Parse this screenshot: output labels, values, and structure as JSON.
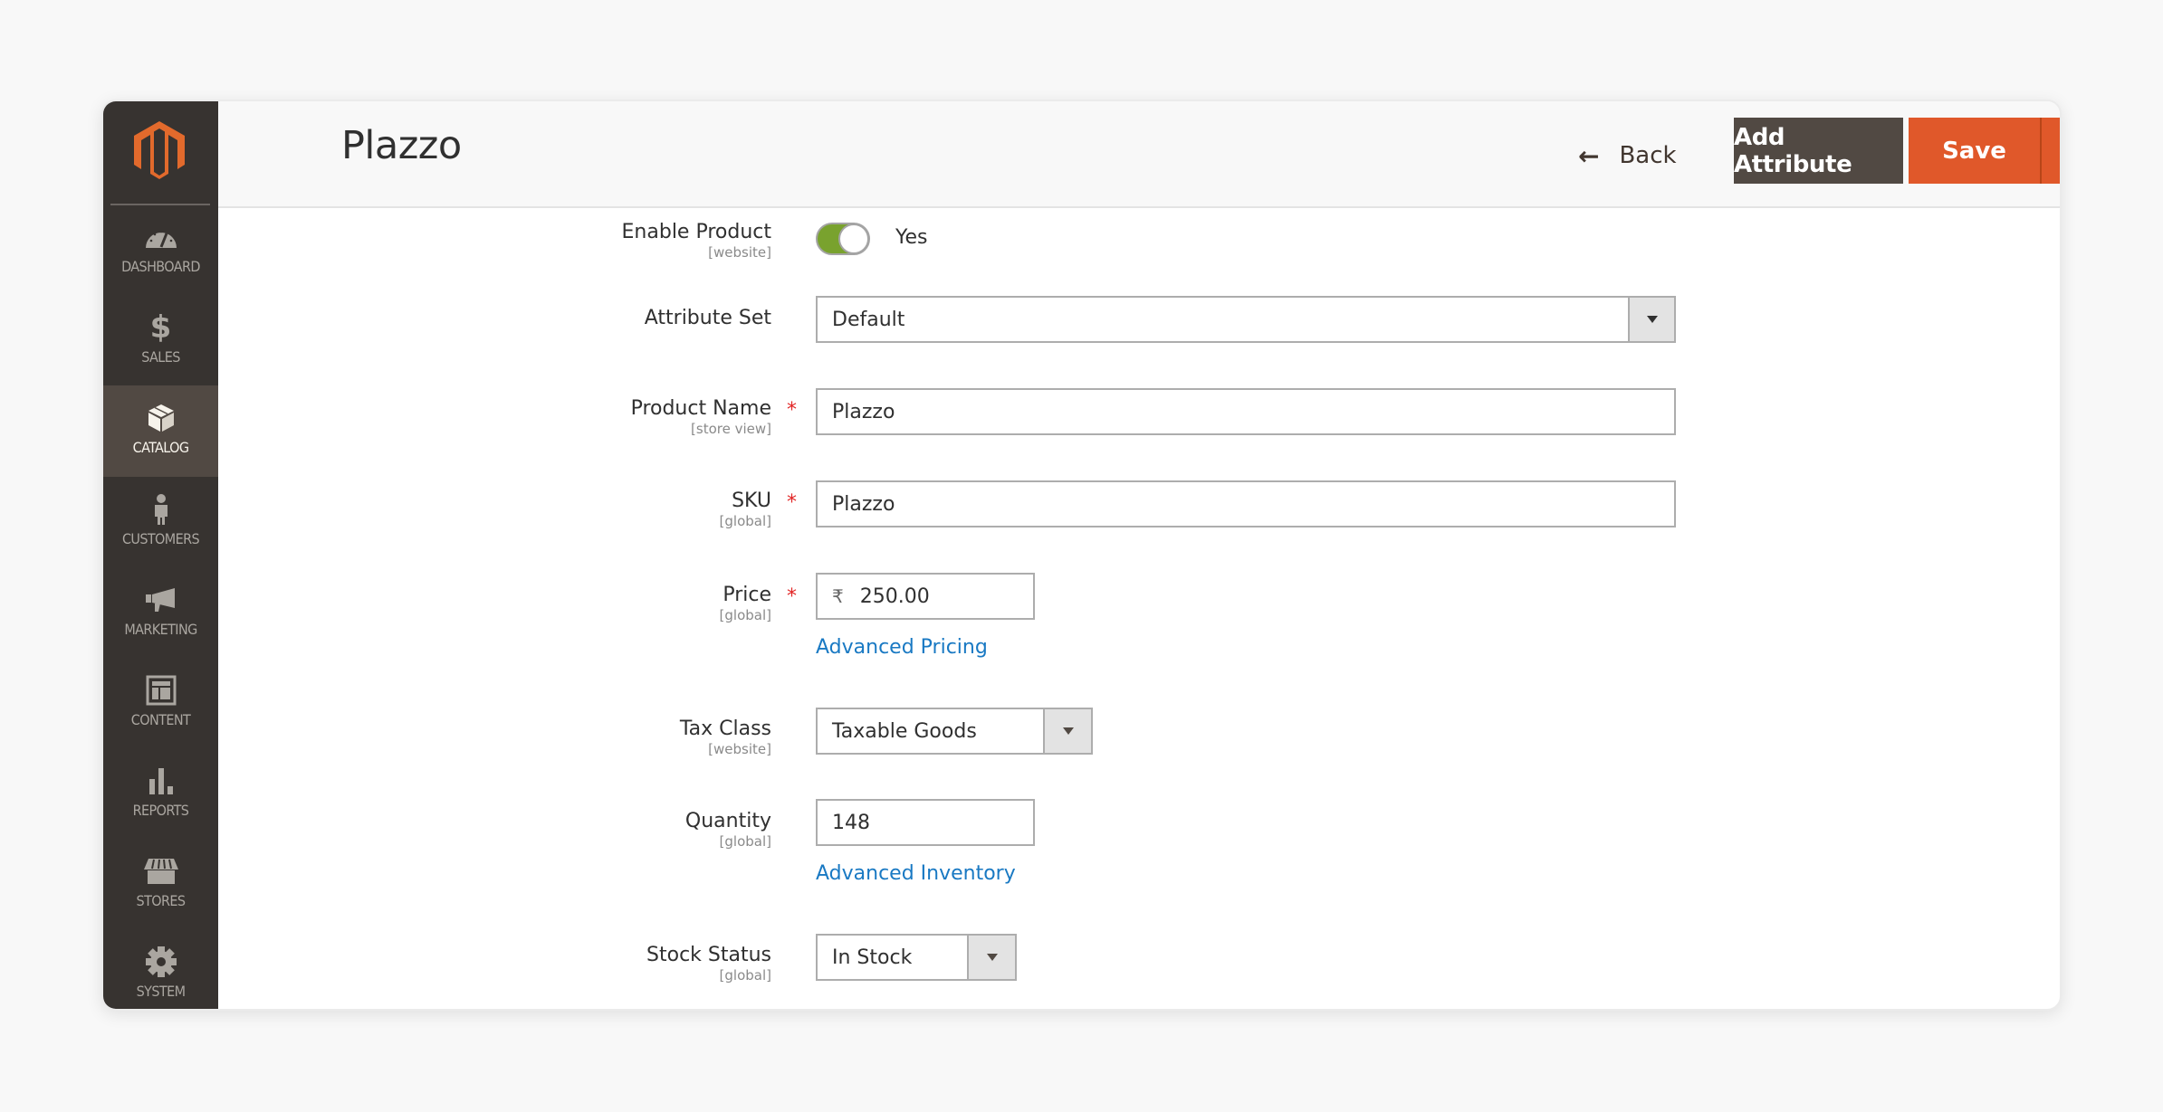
{
  "colors": {
    "brand_orange": "#e0582a",
    "sidebar_bg": "#373330",
    "sidebar_active_bg": "#514943",
    "toggle_on": "#79a22e",
    "link": "#1979c3",
    "required": "#e22626"
  },
  "sidebar": {
    "logo_icon": "magento-logo-icon",
    "items": [
      {
        "label": "DASHBOARD",
        "icon": "dashboard-gauge-icon",
        "active": false
      },
      {
        "label": "SALES",
        "icon": "dollar-icon",
        "active": false
      },
      {
        "label": "CATALOG",
        "icon": "box-icon",
        "active": true
      },
      {
        "label": "CUSTOMERS",
        "icon": "person-icon",
        "active": false
      },
      {
        "label": "MARKETING",
        "icon": "megaphone-icon",
        "active": false
      },
      {
        "label": "CONTENT",
        "icon": "layout-icon",
        "active": false
      },
      {
        "label": "REPORTS",
        "icon": "bar-chart-icon",
        "active": false
      },
      {
        "label": "STORES",
        "icon": "storefront-icon",
        "active": false
      },
      {
        "label": "SYSTEM",
        "icon": "gear-icon",
        "active": false
      }
    ]
  },
  "header": {
    "title": "Plazzo",
    "back_label": "Back",
    "back_icon": "arrow-left-icon",
    "add_attribute_label": "Add Attribute",
    "save_label": "Save",
    "save_menu_icon": "caret-down-icon"
  },
  "form": {
    "enable_product": {
      "label": "Enable Product",
      "scope": "[website]",
      "value": "Yes",
      "checked": true
    },
    "attribute_set": {
      "label": "Attribute Set",
      "value": "Default"
    },
    "product_name": {
      "label": "Product Name",
      "scope": "[store view]",
      "required": "*",
      "value": "Plazzo"
    },
    "sku": {
      "label": "SKU",
      "scope": "[global]",
      "required": "*",
      "value": "Plazzo"
    },
    "price": {
      "label": "Price",
      "scope": "[global]",
      "required": "*",
      "currency": "₹",
      "value": "250.00",
      "link": "Advanced Pricing"
    },
    "tax_class": {
      "label": "Tax Class",
      "scope": "[website]",
      "value": "Taxable Goods"
    },
    "quantity": {
      "label": "Quantity",
      "scope": "[global]",
      "value": "148",
      "link": "Advanced Inventory"
    },
    "stock_status": {
      "label": "Stock Status",
      "scope": "[global]",
      "value": "In Stock"
    }
  }
}
